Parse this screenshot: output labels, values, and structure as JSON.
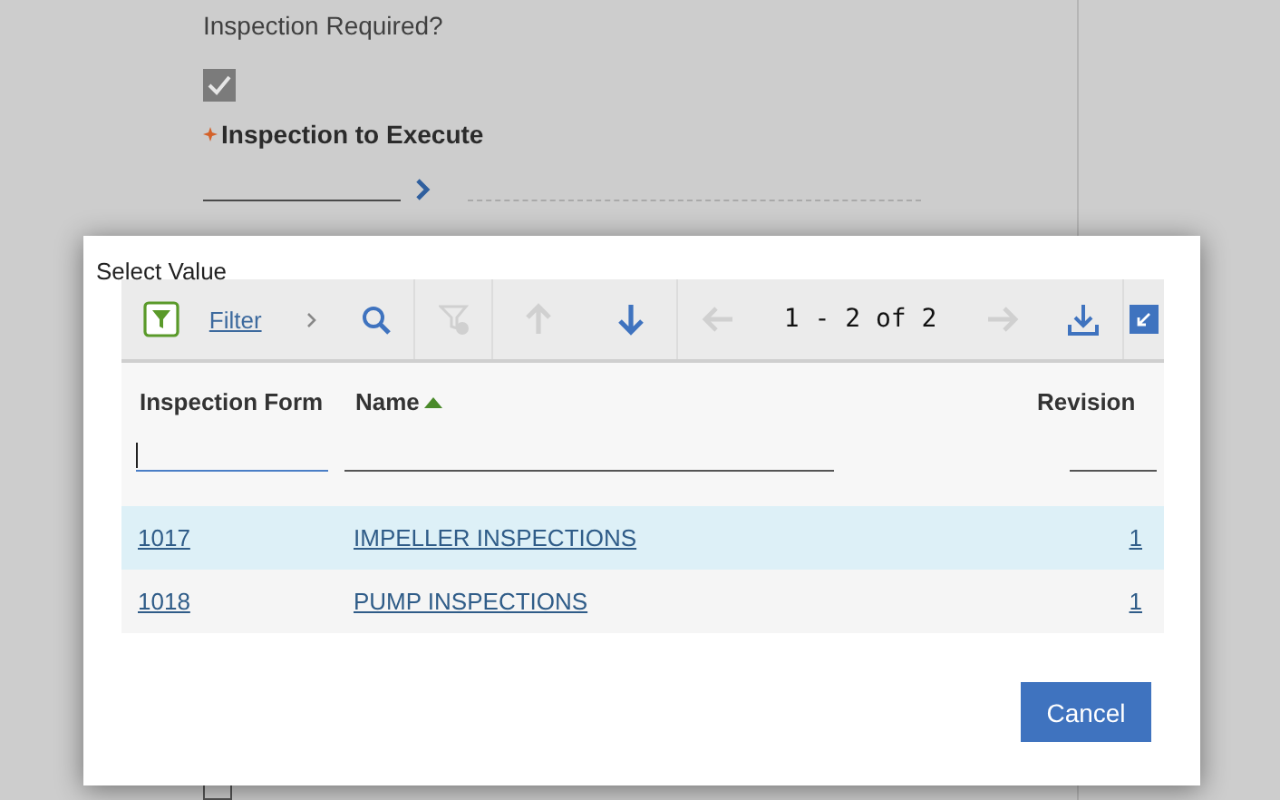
{
  "form": {
    "label": "Inspection Required?",
    "checkbox": {
      "checked": true,
      "disabled": true
    },
    "required_field": {
      "label": "Inspection to Execute",
      "required": true
    },
    "next_checkbox": {
      "checked": false
    }
  },
  "dialog": {
    "title": "Select Value",
    "toolbar": {
      "groups": [
        [
          {
            "kind": "filter",
            "label": "Filter",
            "disabled": false
          },
          {
            "kind": "chevron",
            "disabled": false
          },
          {
            "kind": "search",
            "disabled": false
          }
        ],
        [
          {
            "kind": "clear-filter",
            "disabled": true
          }
        ],
        [
          {
            "kind": "up",
            "disabled": true
          },
          {
            "kind": "down",
            "disabled": false
          }
        ],
        [
          {
            "kind": "prev",
            "disabled": true
          },
          {
            "kind": "pages",
            "label": "1 - 2 of 2",
            "disabled": false
          },
          {
            "kind": "next",
            "disabled": true
          },
          {
            "kind": "download",
            "disabled": false
          }
        ],
        [
          {
            "kind": "collapse",
            "disabled": false
          }
        ]
      ]
    },
    "columns": [
      {
        "label": "Inspection Form",
        "sorted": false
      },
      {
        "label": "Name",
        "sorted": true
      },
      {
        "label": "Revision",
        "sorted": false
      }
    ],
    "rows": [
      {
        "cells": [
          "1017",
          "IMPELLER INSPECTIONS",
          "1"
        ],
        "selected": true
      },
      {
        "cells": [
          "1018",
          "PUMP INSPECTIONS",
          "1"
        ],
        "selected": false
      }
    ],
    "cancel": "Cancel"
  }
}
